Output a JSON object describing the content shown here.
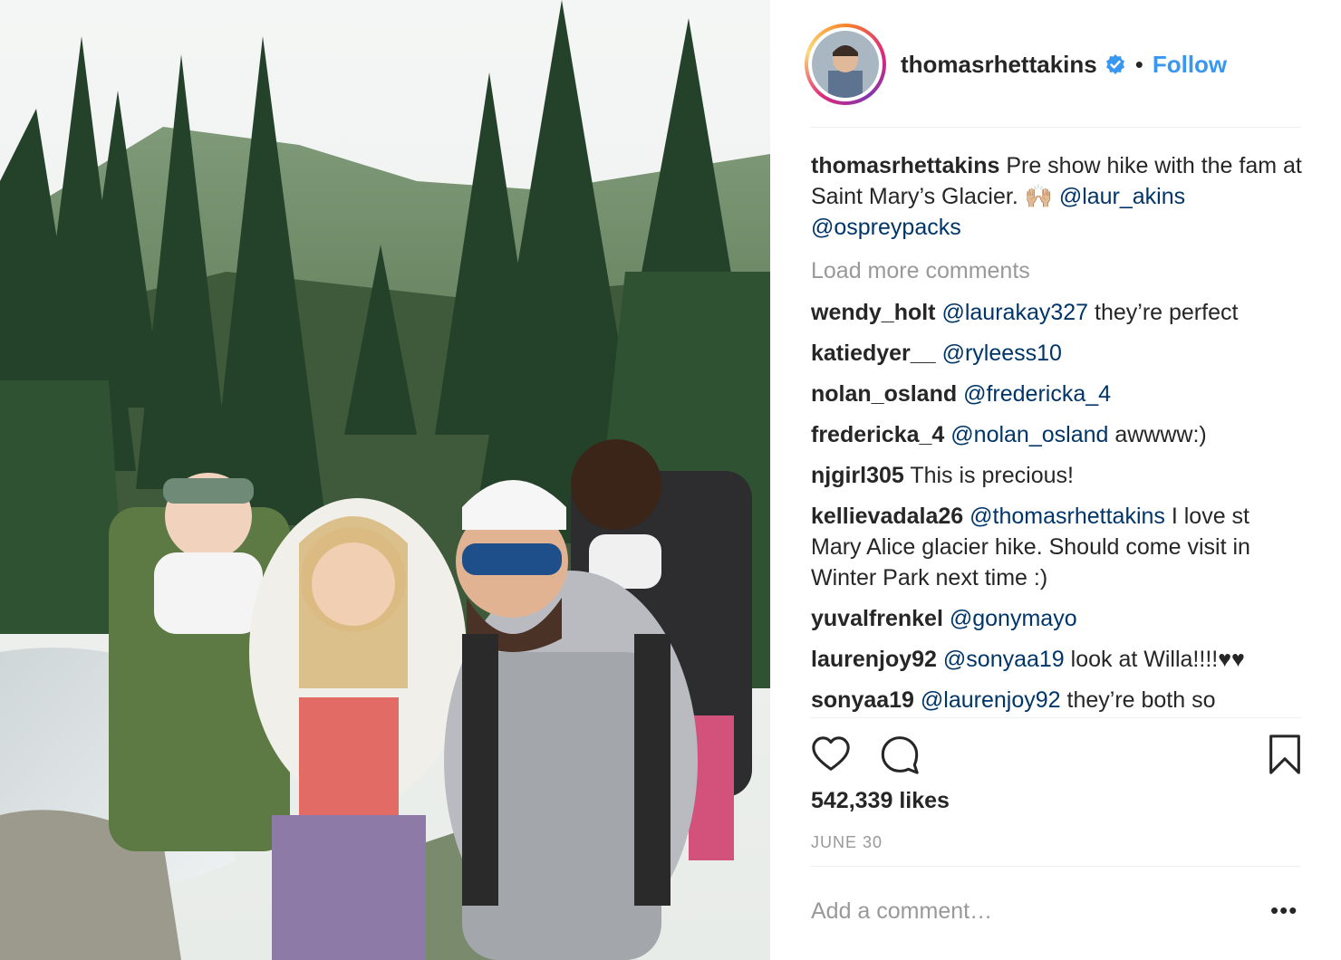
{
  "post": {
    "username": "thomasrhettakins",
    "follow_label": "Follow",
    "separator": "•",
    "caption": {
      "username": "thomasrhettakins",
      "text_1": " Pre show hike with the fam at Saint Mary’s Glacier. 🙌🏼 ",
      "mention_1": "@laur_akins",
      "mention_2": "@ospreypacks"
    },
    "load_more_label": "Load more comments",
    "comments": [
      {
        "user": "wendy_holt",
        "mention": "@laurakay327",
        "text": " they’re perfect"
      },
      {
        "user": "katiedyer__",
        "mention": "@ryleess10",
        "text": ""
      },
      {
        "user": "nolan_osland",
        "mention": "@fredericka_4",
        "text": ""
      },
      {
        "user": "fredericka_4",
        "mention": "@nolan_osland",
        "text": " awwww:)"
      },
      {
        "user": "njgirl305",
        "mention": "",
        "text": "This is precious!"
      },
      {
        "user": "kellievadala26",
        "mention": "@thomasrhettakins",
        "text": " I love st Mary Alice glacier hike. Should come visit in Winter Park next time :)"
      },
      {
        "user": "yuvalfrenkel",
        "mention": "@gonymayo",
        "text": ""
      },
      {
        "user": "laurenjoy92",
        "mention": "@sonyaa19",
        "text": " look at Willa!!!!♥♥"
      },
      {
        "user": "sonyaa19",
        "mention": "@laurenjoy92",
        "text": " they’re both so"
      }
    ],
    "likes": "542,339 likes",
    "date": "JUNE 30",
    "add_comment_placeholder": "Add a comment…",
    "more_label": "•••"
  },
  "icons": {
    "like": "heart-icon",
    "comment": "comment-icon",
    "save": "bookmark-icon",
    "verified": "verified-badge-icon"
  },
  "colors": {
    "follow": "#3897f0",
    "mention": "#003569",
    "muted": "#999999",
    "verified": "#3897f0"
  }
}
